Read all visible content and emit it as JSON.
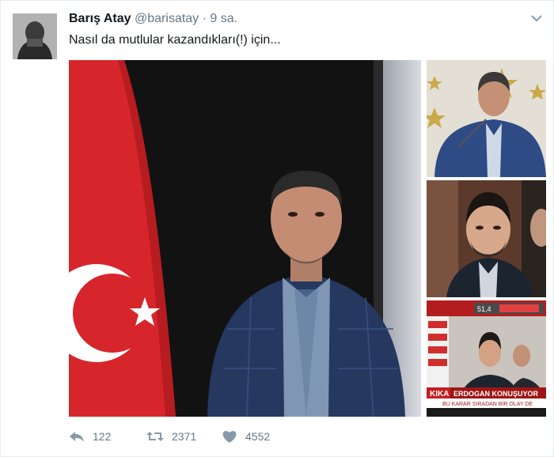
{
  "tweet": {
    "author_name": "Barış Atay",
    "handle": "@barisatay",
    "separator": "·",
    "time": "9 sa.",
    "text": "Nasıl da mutlular kazandıkları(!) için..."
  },
  "media": {
    "tv_banner": "ERDOGAN KONUŞUYOR",
    "tv_subtitle": "BU KARAR SIRADAN BİR OLAY DE",
    "tv_channel": "KIKA",
    "tv_score": "51,4"
  },
  "actions": {
    "reply_count": "122",
    "retweet_count": "2371",
    "like_count": "4552"
  },
  "colors": {
    "flag_red": "#d7262b",
    "bg_dark": "#131313",
    "suit": "#26385f"
  }
}
